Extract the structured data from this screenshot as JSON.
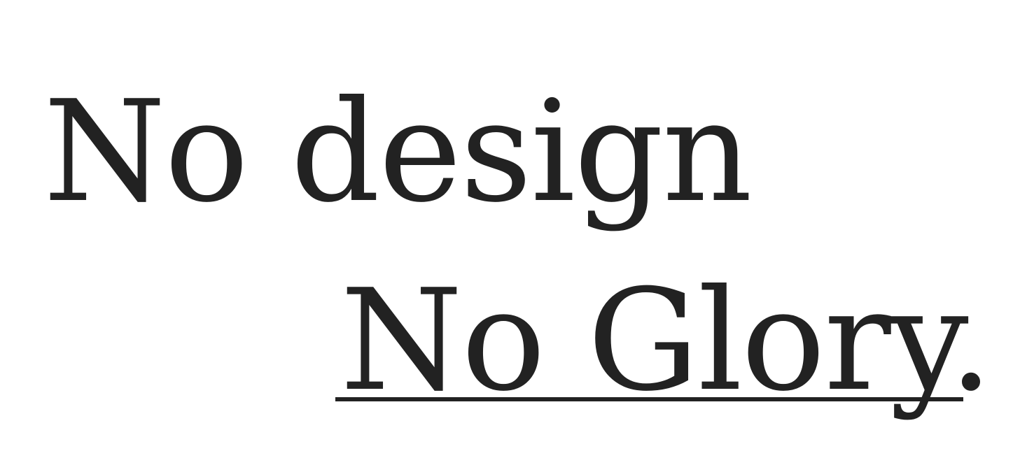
{
  "headline": {
    "line_1": "No design",
    "line_2": "No Glory."
  },
  "colors": {
    "background": "#ffffff",
    "text": "#222222"
  }
}
